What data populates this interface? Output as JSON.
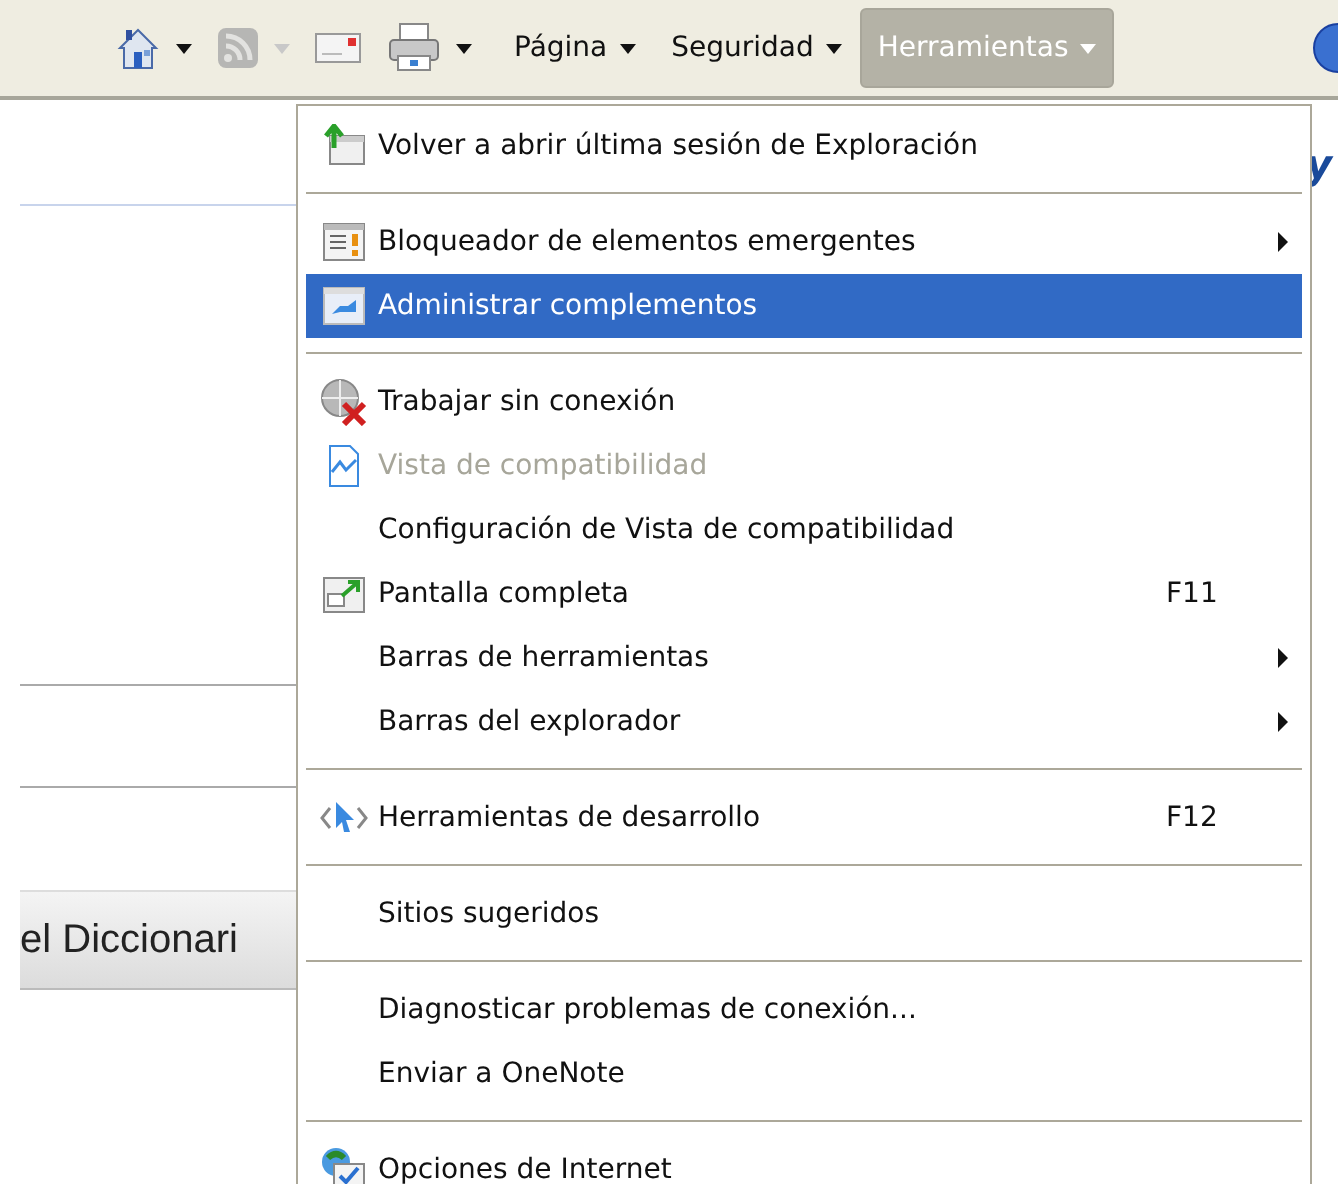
{
  "toolbar": {
    "buttons": [
      {
        "dropdown": true,
        "disabled": false
      },
      {
        "dropdown": true,
        "disabled": true
      },
      {
        "dropdown": false,
        "disabled": false
      },
      {
        "dropdown": true,
        "disabled": false
      }
    ],
    "menus": [
      {
        "label": "Página",
        "open": false
      },
      {
        "label": "Seguridad",
        "open": false
      },
      {
        "label": "Herramientas",
        "open": true
      }
    ]
  },
  "page": {
    "heading_fragment": "y",
    "button_label": "el Diccionari"
  },
  "menu": {
    "items": [
      {
        "kind": "item",
        "label": "Volver a abrir última sesión de Exploración",
        "submenu": false,
        "selected": false,
        "disabled": false
      },
      {
        "kind": "separator"
      },
      {
        "kind": "item",
        "label": "Bloqueador de elementos emergentes",
        "submenu": true,
        "selected": false,
        "disabled": false
      },
      {
        "kind": "item",
        "label": "Administrar complementos",
        "submenu": false,
        "selected": true,
        "disabled": false
      },
      {
        "kind": "separator"
      },
      {
        "kind": "item",
        "label": "Trabajar sin conexión",
        "submenu": false,
        "selected": false,
        "disabled": false
      },
      {
        "kind": "item",
        "label": "Vista de compatibilidad",
        "submenu": false,
        "selected": false,
        "disabled": true
      },
      {
        "kind": "item",
        "label": "Configuración de Vista de compatibilidad",
        "submenu": false,
        "selected": false,
        "disabled": false
      },
      {
        "kind": "item",
        "label": "Pantalla completa",
        "shortcut": "F11",
        "submenu": false,
        "selected": false,
        "disabled": false
      },
      {
        "kind": "item",
        "label": "Barras de herramientas",
        "submenu": true,
        "selected": false,
        "disabled": false
      },
      {
        "kind": "item",
        "label": "Barras del explorador",
        "submenu": true,
        "selected": false,
        "disabled": false
      },
      {
        "kind": "separator"
      },
      {
        "kind": "item",
        "label": "Herramientas de desarrollo",
        "shortcut": "F12",
        "submenu": false,
        "selected": false,
        "disabled": false
      },
      {
        "kind": "separator"
      },
      {
        "kind": "item",
        "label": "Sitios sugeridos",
        "submenu": false,
        "selected": false,
        "disabled": false
      },
      {
        "kind": "separator"
      },
      {
        "kind": "item",
        "label": "Diagnosticar problemas de conexión...",
        "submenu": false,
        "selected": false,
        "disabled": false
      },
      {
        "kind": "item",
        "label": "Enviar a OneNote",
        "submenu": false,
        "selected": false,
        "disabled": false
      },
      {
        "kind": "separator"
      },
      {
        "kind": "item",
        "label": "Opciones de Internet",
        "submenu": false,
        "selected": false,
        "disabled": false
      }
    ]
  }
}
